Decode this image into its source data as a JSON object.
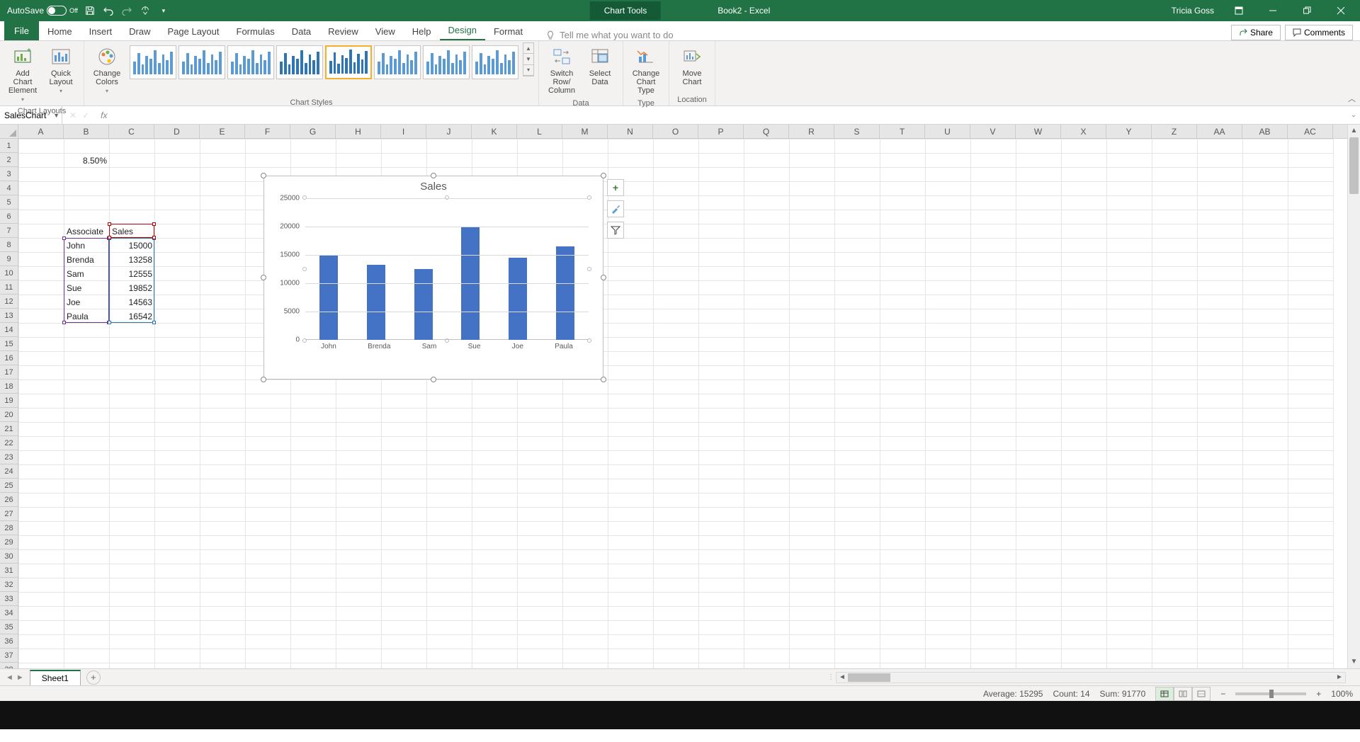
{
  "titlebar": {
    "autosave_label": "AutoSave",
    "autosave_state": "Off",
    "contextual_tab": "Chart Tools",
    "doc_title": "Book2 - Excel",
    "user": "Tricia Goss"
  },
  "tabs": {
    "file": "File",
    "home": "Home",
    "insert": "Insert",
    "draw": "Draw",
    "page_layout": "Page Layout",
    "formulas": "Formulas",
    "data": "Data",
    "review": "Review",
    "view": "View",
    "help": "Help",
    "design": "Design",
    "format": "Format",
    "tellme": "Tell me what you want to do",
    "share": "Share",
    "comments": "Comments"
  },
  "ribbon": {
    "chart_layouts": {
      "add_element": "Add Chart Element",
      "quick_layout": "Quick Layout",
      "group": "Chart Layouts"
    },
    "change_colors": "Change Colors",
    "chart_styles_group": "Chart Styles",
    "data": {
      "switch": "Switch Row/ Column",
      "select": "Select Data",
      "group": "Data"
    },
    "type": {
      "change": "Change Chart Type",
      "group": "Type"
    },
    "location": {
      "move": "Move Chart",
      "group": "Location"
    }
  },
  "name_box": "SalesChart",
  "columns": [
    "A",
    "B",
    "C",
    "D",
    "E",
    "F",
    "G",
    "H",
    "I",
    "J",
    "K",
    "L",
    "M",
    "N",
    "O",
    "P",
    "Q",
    "R",
    "S",
    "T",
    "U",
    "V",
    "W",
    "X",
    "Y",
    "Z",
    "AA",
    "AB",
    "AC"
  ],
  "row_count": 38,
  "cell_b2": "8.50%",
  "table": {
    "headers": {
      "associate": "Associate",
      "sales": "Sales"
    },
    "rows": [
      {
        "name": "John",
        "sales": 15000
      },
      {
        "name": "Brenda",
        "sales": 13258
      },
      {
        "name": "Sam",
        "sales": 12555
      },
      {
        "name": "Sue",
        "sales": 19852
      },
      {
        "name": "Joe",
        "sales": 14563
      },
      {
        "name": "Paula",
        "sales": 16542
      }
    ]
  },
  "chart_data": {
    "type": "bar",
    "title": "Sales",
    "categories": [
      "John",
      "Brenda",
      "Sam",
      "Sue",
      "Joe",
      "Paula"
    ],
    "values": [
      15000,
      13258,
      12555,
      19852,
      14563,
      16542
    ],
    "ylim": [
      0,
      25000
    ],
    "yticks": [
      0,
      5000,
      10000,
      15000,
      20000,
      25000
    ],
    "xlabel": "",
    "ylabel": ""
  },
  "chart_side": {
    "elements": "+",
    "styles": "brush",
    "filter": "funnel"
  },
  "sheet": {
    "name": "Sheet1"
  },
  "status": {
    "average_label": "Average:",
    "average": "15295",
    "count_label": "Count:",
    "count": "14",
    "sum_label": "Sum:",
    "sum": "91770",
    "zoom": "100%"
  }
}
